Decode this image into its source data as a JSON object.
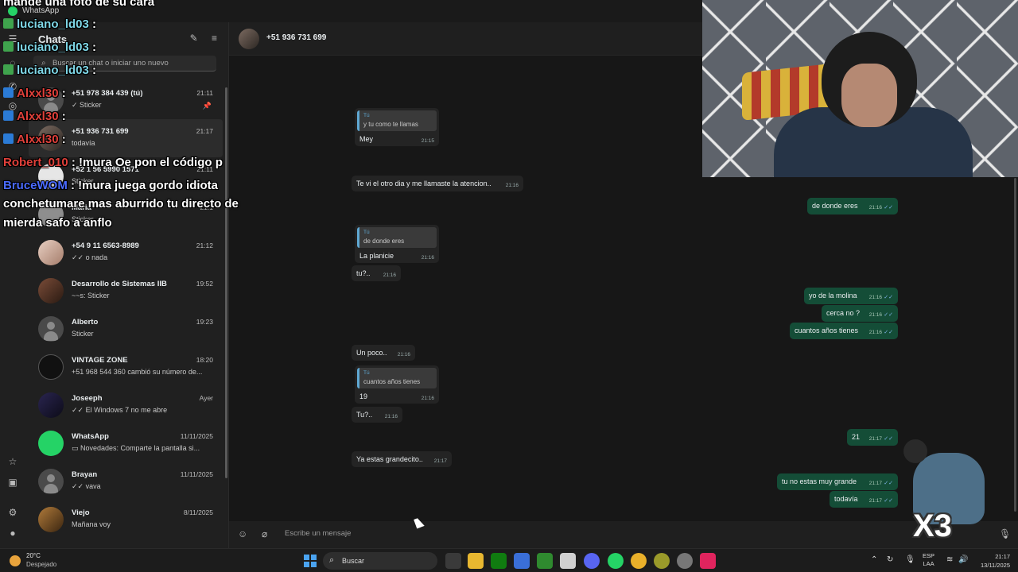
{
  "window": {
    "title": "WhatsApp"
  },
  "sidebar": {
    "title": "Chats",
    "search_placeholder": "Buscar un chat o iniciar uno nuevo",
    "chats": [
      {
        "name": "+51 978 384 439 (tú)",
        "time": "21:11",
        "message": "Sticker",
        "pinned": true
      },
      {
        "name": "+51 936 731 699",
        "time": "21:17",
        "message": "todavía",
        "active": true
      },
      {
        "name": "+52 1 56 5990 1571",
        "time": "21:11",
        "message": "Sticker"
      },
      {
        "name": "Maria",
        "time": "21:1",
        "message": "Sticker"
      },
      {
        "name": "+54 9 11 6563-8989",
        "time": "21:12",
        "message": "o nada"
      },
      {
        "name": "Desarrollo de Sistemas IIB",
        "time": "19:52",
        "message": "~~s: Sticker"
      },
      {
        "name": "Alberto",
        "time": "19:23",
        "message": "Sticker"
      },
      {
        "name": "VINTAGE ZONE",
        "time": "18:20",
        "message": "+51 968 544 360 cambió su número de..."
      },
      {
        "name": "Joseeph",
        "time": "Ayer",
        "message": "El Windows 7 no me abre"
      },
      {
        "name": "WhatsApp",
        "time": "11/11/2025",
        "message": "Novedades: Comparte la pantalla si..."
      },
      {
        "name": "Brayan",
        "time": "11/11/2025",
        "message": "vava"
      },
      {
        "name": "Viejo",
        "time": "8/11/2025",
        "message": "Mañana voy"
      }
    ]
  },
  "conversation": {
    "contact": "+51 936 731 699",
    "composer_placeholder": "Escribe un mensaje",
    "messages": [
      {
        "dir": "in",
        "quote_author": "Tú",
        "quote": "y tu como te llamas",
        "text": "Mey",
        "time": "21:15"
      },
      {
        "dir": "in",
        "text": "Te vi el otro dia y me llamaste la atencion..",
        "time": "21:16"
      },
      {
        "dir": "out",
        "text": "de donde eres",
        "time": "21:16"
      },
      {
        "dir": "in",
        "quote_author": "Tú",
        "quote": "de donde eres",
        "text": "La planicie",
        "time": "21:16"
      },
      {
        "dir": "in",
        "text": "tu?..",
        "time": "21:16"
      },
      {
        "dir": "out",
        "text": "yo de la molina",
        "time": "21:16"
      },
      {
        "dir": "out",
        "text": "cerca no ?",
        "time": "21:16"
      },
      {
        "dir": "out",
        "text": "cuantos años tienes",
        "time": "21:16"
      },
      {
        "dir": "in",
        "text": "Un poco..",
        "time": "21:16"
      },
      {
        "dir": "in",
        "quote_author": "Tú",
        "quote": "cuantos años tienes",
        "text": "19",
        "time": "21:16"
      },
      {
        "dir": "in",
        "text": "Tu?..",
        "time": "21:16"
      },
      {
        "dir": "out",
        "text": "21",
        "time": "21:17"
      },
      {
        "dir": "in",
        "text": "Ya estas grandecito..",
        "time": "21:17"
      },
      {
        "dir": "out",
        "text": "tu no estas muy grande",
        "time": "21:17"
      },
      {
        "dir": "out",
        "text": "todavía",
        "time": "21:17"
      }
    ]
  },
  "stream_overlay": {
    "lines": [
      {
        "user": "",
        "text": "mande una foto de su cara"
      },
      {
        "user": "luciano_ld03",
        "text": ":"
      },
      {
        "user": "luciano_ld03",
        "text": ":"
      },
      {
        "user": "luciano_ld03",
        "text": ":"
      },
      {
        "user": "Alxxl30",
        "text": ":"
      },
      {
        "user": "Alxxl30",
        "text": ":"
      },
      {
        "user": "Alxxl30",
        "text": ":"
      },
      {
        "user": "Robert_010",
        "text": ": !mura Oe pon el código p"
      },
      {
        "user": "BruceWOM",
        "text": ": !mura juega gordo idiota"
      },
      {
        "user": "",
        "text": "conchetumare mas aburrido tu directo de"
      },
      {
        "user": "",
        "text": "mierda safo a anflo"
      }
    ],
    "sticker_text": "X3"
  },
  "taskbar": {
    "temperature": "20°C",
    "condition": "Despejado",
    "search": "Buscar",
    "lang_top": "ESP",
    "lang_bottom": "LAA",
    "time": "21:17",
    "date": "13/11/2025"
  },
  "colors": {
    "accent_green": "#25d366",
    "outgoing_bubble": "#144d37",
    "incoming_bubble": "#242424",
    "quote_bar": "#5fa8d3"
  }
}
